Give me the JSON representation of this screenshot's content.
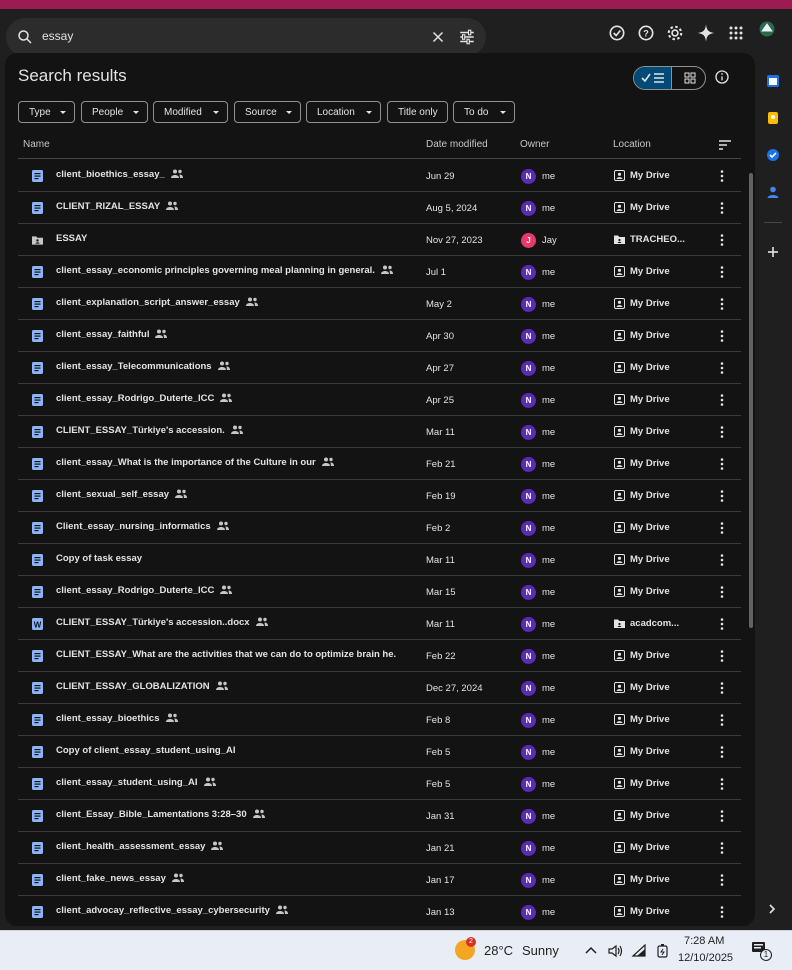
{
  "search": {
    "query": "essay"
  },
  "panel": {
    "title": "Search results"
  },
  "filters": [
    {
      "label": "Type"
    },
    {
      "label": "People"
    },
    {
      "label": "Modified"
    },
    {
      "label": "Source"
    },
    {
      "label": "Location"
    },
    {
      "label": "Title only"
    },
    {
      "label": "To do"
    }
  ],
  "columns": {
    "name": "Name",
    "date": "Date modified",
    "owner": "Owner",
    "location": "Location"
  },
  "rows": [
    {
      "name": "client_bioethics_essay_",
      "type": "doc",
      "shared": true,
      "date": "Jun 29",
      "owner_initial": "N",
      "owner": "me",
      "location": "My Drive",
      "loc_type": "drive"
    },
    {
      "name": "CLIENT_RIZAL_ESSAY",
      "type": "doc",
      "shared": true,
      "date": "Aug 5, 2024",
      "owner_initial": "N",
      "owner": "me",
      "location": "My Drive",
      "loc_type": "drive"
    },
    {
      "name": "ESSAY",
      "type": "folder",
      "shared": false,
      "date": "Nov 27, 2023",
      "owner_initial": "J",
      "owner": "Jay",
      "location": "TRACHEO...",
      "loc_type": "folder"
    },
    {
      "name": "client_essay_economic principles governing meal planning in general.",
      "type": "doc",
      "shared": true,
      "date": "Jul 1",
      "owner_initial": "N",
      "owner": "me",
      "location": "My Drive",
      "loc_type": "drive"
    },
    {
      "name": "client_explanation_script_answer_essay",
      "type": "doc",
      "shared": true,
      "date": "May 2",
      "owner_initial": "N",
      "owner": "me",
      "location": "My Drive",
      "loc_type": "drive"
    },
    {
      "name": "client_essay_faithful",
      "type": "doc",
      "shared": true,
      "date": "Apr 30",
      "owner_initial": "N",
      "owner": "me",
      "location": "My Drive",
      "loc_type": "drive"
    },
    {
      "name": "client_essay_Telecommunications",
      "type": "doc",
      "shared": true,
      "date": "Apr 27",
      "owner_initial": "N",
      "owner": "me",
      "location": "My Drive",
      "loc_type": "drive"
    },
    {
      "name": "client_essay_Rodrigo_Duterte_ICC",
      "type": "doc",
      "shared": true,
      "date": "Apr 25",
      "owner_initial": "N",
      "owner": "me",
      "location": "My Drive",
      "loc_type": "drive"
    },
    {
      "name": "CLIENT_ESSAY_Türkiye's accession.",
      "type": "doc",
      "shared": true,
      "date": "Mar 11",
      "owner_initial": "N",
      "owner": "me",
      "location": "My Drive",
      "loc_type": "drive"
    },
    {
      "name": "client_essay_What is the importance of the Culture in our",
      "type": "doc",
      "shared": true,
      "date": "Feb 21",
      "owner_initial": "N",
      "owner": "me",
      "location": "My Drive",
      "loc_type": "drive"
    },
    {
      "name": "client_sexual_self_essay",
      "type": "doc",
      "shared": true,
      "date": "Feb 19",
      "owner_initial": "N",
      "owner": "me",
      "location": "My Drive",
      "loc_type": "drive"
    },
    {
      "name": "Client_essay_nursing_informatics",
      "type": "doc",
      "shared": true,
      "date": "Feb 2",
      "owner_initial": "N",
      "owner": "me",
      "location": "My Drive",
      "loc_type": "drive"
    },
    {
      "name": "Copy of task essay",
      "type": "doc",
      "shared": false,
      "date": "Mar 11",
      "owner_initial": "N",
      "owner": "me",
      "location": "My Drive",
      "loc_type": "drive"
    },
    {
      "name": "client_essay_Rodrigo_Duterte_ICC",
      "type": "doc",
      "shared": true,
      "date": "Mar 15",
      "owner_initial": "N",
      "owner": "me",
      "location": "My Drive",
      "loc_type": "drive"
    },
    {
      "name": "CLIENT_ESSAY_Türkiye's accession..docx",
      "type": "word",
      "shared": true,
      "date": "Mar 11",
      "owner_initial": "N",
      "owner": "me",
      "location": "acadcom...",
      "loc_type": "folder"
    },
    {
      "name": "CLIENT_ESSAY_What are the activities that we can do to optimize brain he...",
      "type": "doc",
      "shared": true,
      "date": "Feb 22",
      "owner_initial": "N",
      "owner": "me",
      "location": "My Drive",
      "loc_type": "drive"
    },
    {
      "name": "CLIENT_ESSAY_GLOBALIZATION",
      "type": "doc",
      "shared": true,
      "date": "Dec 27, 2024",
      "owner_initial": "N",
      "owner": "me",
      "location": "My Drive",
      "loc_type": "drive"
    },
    {
      "name": "client_essay_bioethics",
      "type": "doc",
      "shared": true,
      "date": "Feb 8",
      "owner_initial": "N",
      "owner": "me",
      "location": "My Drive",
      "loc_type": "drive"
    },
    {
      "name": "Copy of client_essay_student_using_AI",
      "type": "doc",
      "shared": false,
      "date": "Feb 5",
      "owner_initial": "N",
      "owner": "me",
      "location": "My Drive",
      "loc_type": "drive"
    },
    {
      "name": "client_essay_student_using_AI",
      "type": "doc",
      "shared": true,
      "date": "Feb 5",
      "owner_initial": "N",
      "owner": "me",
      "location": "My Drive",
      "loc_type": "drive"
    },
    {
      "name": "client_Essay_Bible_Lamentations 3:28–30",
      "type": "doc",
      "shared": true,
      "date": "Jan 31",
      "owner_initial": "N",
      "owner": "me",
      "location": "My Drive",
      "loc_type": "drive"
    },
    {
      "name": "client_health_assessment_essay",
      "type": "doc",
      "shared": true,
      "date": "Jan 21",
      "owner_initial": "N",
      "owner": "me",
      "location": "My Drive",
      "loc_type": "drive"
    },
    {
      "name": "client_fake_news_essay",
      "type": "doc",
      "shared": true,
      "date": "Jan 17",
      "owner_initial": "N",
      "owner": "me",
      "location": "My Drive",
      "loc_type": "drive"
    },
    {
      "name": "client_advocay_reflective_essay_cybersecurity",
      "type": "doc",
      "shared": true,
      "date": "Jan 13",
      "owner_initial": "N",
      "owner": "me",
      "location": "My Drive",
      "loc_type": "drive"
    }
  ],
  "taskbar": {
    "temp": "28°C",
    "condition": "Sunny",
    "weather_badge": "2",
    "time": "7:28 AM",
    "date": "12/10/2025",
    "notif_count": "1"
  },
  "colors": {
    "accent": "#004a77",
    "owner_me": "#5b2bb5",
    "owner_jay": "#e8396a",
    "doc_blue": "#8ab4f8",
    "background": "#131313"
  }
}
